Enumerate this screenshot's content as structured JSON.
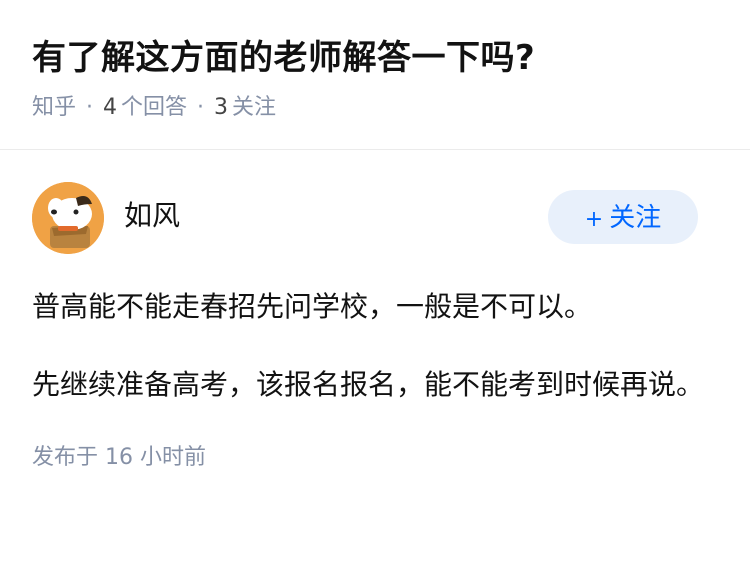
{
  "question": {
    "title": "有了解这方面的老师解答一下吗?",
    "source": "知乎",
    "answers_count": "4",
    "answers_label": "个回答",
    "followers_count": "3",
    "followers_label": "关注"
  },
  "answer": {
    "author": {
      "name": "如风",
      "avatar_icon": "cartoon-dog-avatar"
    },
    "follow_button": {
      "plus": "+",
      "label": "关注"
    },
    "paragraphs": [
      "普高能不能走春招先问学校，一般是不可以。",
      "先继续准备高考，该报名报名，能不能考到时候再说。"
    ],
    "publish": {
      "prefix": "发布于",
      "time": "16 小时前"
    }
  },
  "colors": {
    "accent": "#0066ff",
    "follow_bg": "#e8f0fb",
    "meta": "#8590a6",
    "avatar_bg": "#f0a245"
  }
}
